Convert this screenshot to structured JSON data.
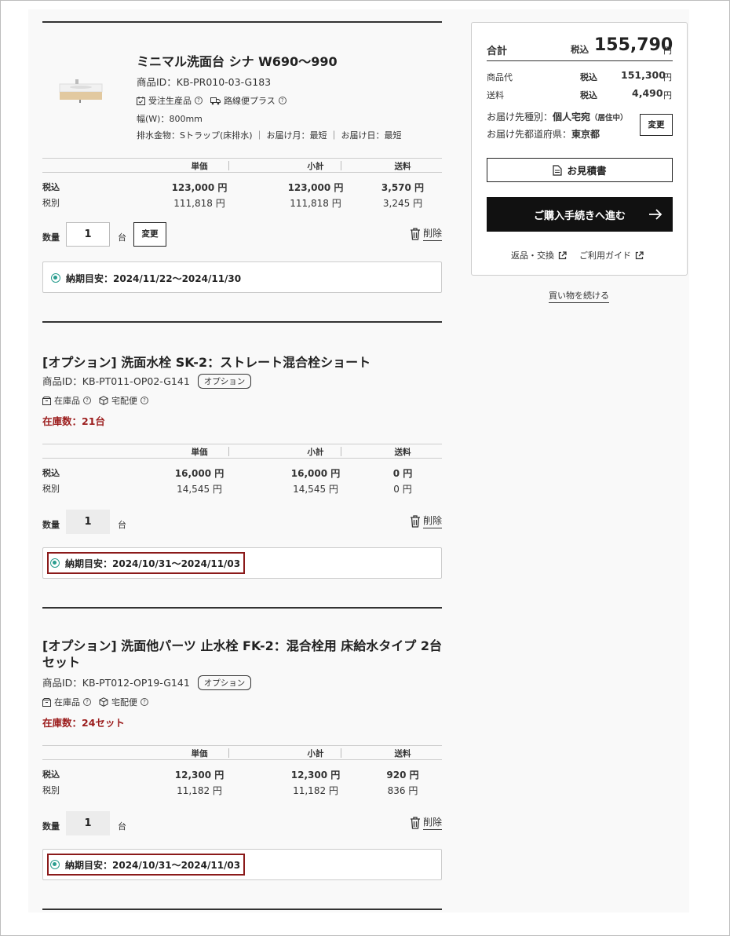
{
  "products": [
    {
      "title": "ミニマル洗面台 シナ W690〜990",
      "id_text": "商品ID：KB-PR010-03-G183",
      "features": [
        "受注生産品",
        "路線便プラス"
      ],
      "width_spec": "幅(W)：800mm",
      "drain_spec": "排水金物：Sトラップ(床排水) ｜ お届け月：最短 ｜ お届け日：最短",
      "headers": {
        "unit": "単価",
        "subtotal": "小計",
        "shipping": "送料"
      },
      "tax_in_label": "税込",
      "tax_ex_label": "税別",
      "tax_in": {
        "unit": "123,000 円",
        "subtotal": "123,000 円",
        "shipping": "3,570 円"
      },
      "tax_ex": {
        "unit": "111,818 円",
        "subtotal": "111,818 円",
        "shipping": "3,245 円"
      },
      "qty_label": "数量",
      "qty": "1",
      "unit_label": "台",
      "change_label": "変更",
      "delete_label": "削除",
      "delivery": "納期目安：2024/11/22〜2024/11/30"
    },
    {
      "title": "[オプション] 洗面水栓 SK-2：ストレート混合栓ショート",
      "id_text": "商品ID：KB-PT011-OP02-G141",
      "tag": "オプション",
      "features": [
        "在庫品",
        "宅配便"
      ],
      "stock": "在庫数：21台",
      "headers": {
        "unit": "単価",
        "subtotal": "小計",
        "shipping": "送料"
      },
      "tax_in_label": "税込",
      "tax_ex_label": "税別",
      "tax_in": {
        "unit": "16,000 円",
        "subtotal": "16,000 円",
        "shipping": "0 円"
      },
      "tax_ex": {
        "unit": "14,545 円",
        "subtotal": "14,545 円",
        "shipping": "0 円"
      },
      "qty_label": "数量",
      "qty": "1",
      "unit_label": "台",
      "delete_label": "削除",
      "delivery": "納期目安：2024/10/31〜2024/11/03"
    },
    {
      "title": "[オプション] 洗面他パーツ 止水栓 FK-2：混合栓用 床給水タイプ 2台セット",
      "id_text": "商品ID：KB-PT012-OP19-G141",
      "tag": "オプション",
      "features": [
        "在庫品",
        "宅配便"
      ],
      "stock": "在庫数：24セット",
      "headers": {
        "unit": "単価",
        "subtotal": "小計",
        "shipping": "送料"
      },
      "tax_in_label": "税込",
      "tax_ex_label": "税別",
      "tax_in": {
        "unit": "12,300 円",
        "subtotal": "12,300 円",
        "shipping": "920 円"
      },
      "tax_ex": {
        "unit": "11,182 円",
        "subtotal": "11,182 円",
        "shipping": "836 円"
      },
      "qty_label": "数量",
      "qty": "1",
      "unit_label": "台",
      "delete_label": "削除",
      "delivery": "納期目安：2024/10/31〜2024/11/03"
    }
  ],
  "summary": {
    "total_label": "合計",
    "tax_in_label": "税込",
    "total_value": "155,790",
    "yen": "円",
    "item_label": "商品代",
    "item_value": "151,300",
    "shipping_label": "送料",
    "shipping_value": "4,490",
    "dest_type_label": "お届け先種別：",
    "dest_type_value": "個人宅宛",
    "dest_type_note": "（居住中）",
    "dest_pref_label": "お届け先都道府県：",
    "dest_pref_value": "東京都",
    "change_label": "変更",
    "quote_label": "お見積書",
    "checkout_label": "ご購入手続きへ進む",
    "returns_label": "返品・交換",
    "guide_label": "ご利用ガイド"
  },
  "continue_label": "買い物を続ける",
  "colors": {
    "accent_teal": "#2a9d8f",
    "stock_red": "#9b1c1c",
    "highlight_border": "#8b1a1a",
    "checkout_bg": "#111111"
  }
}
